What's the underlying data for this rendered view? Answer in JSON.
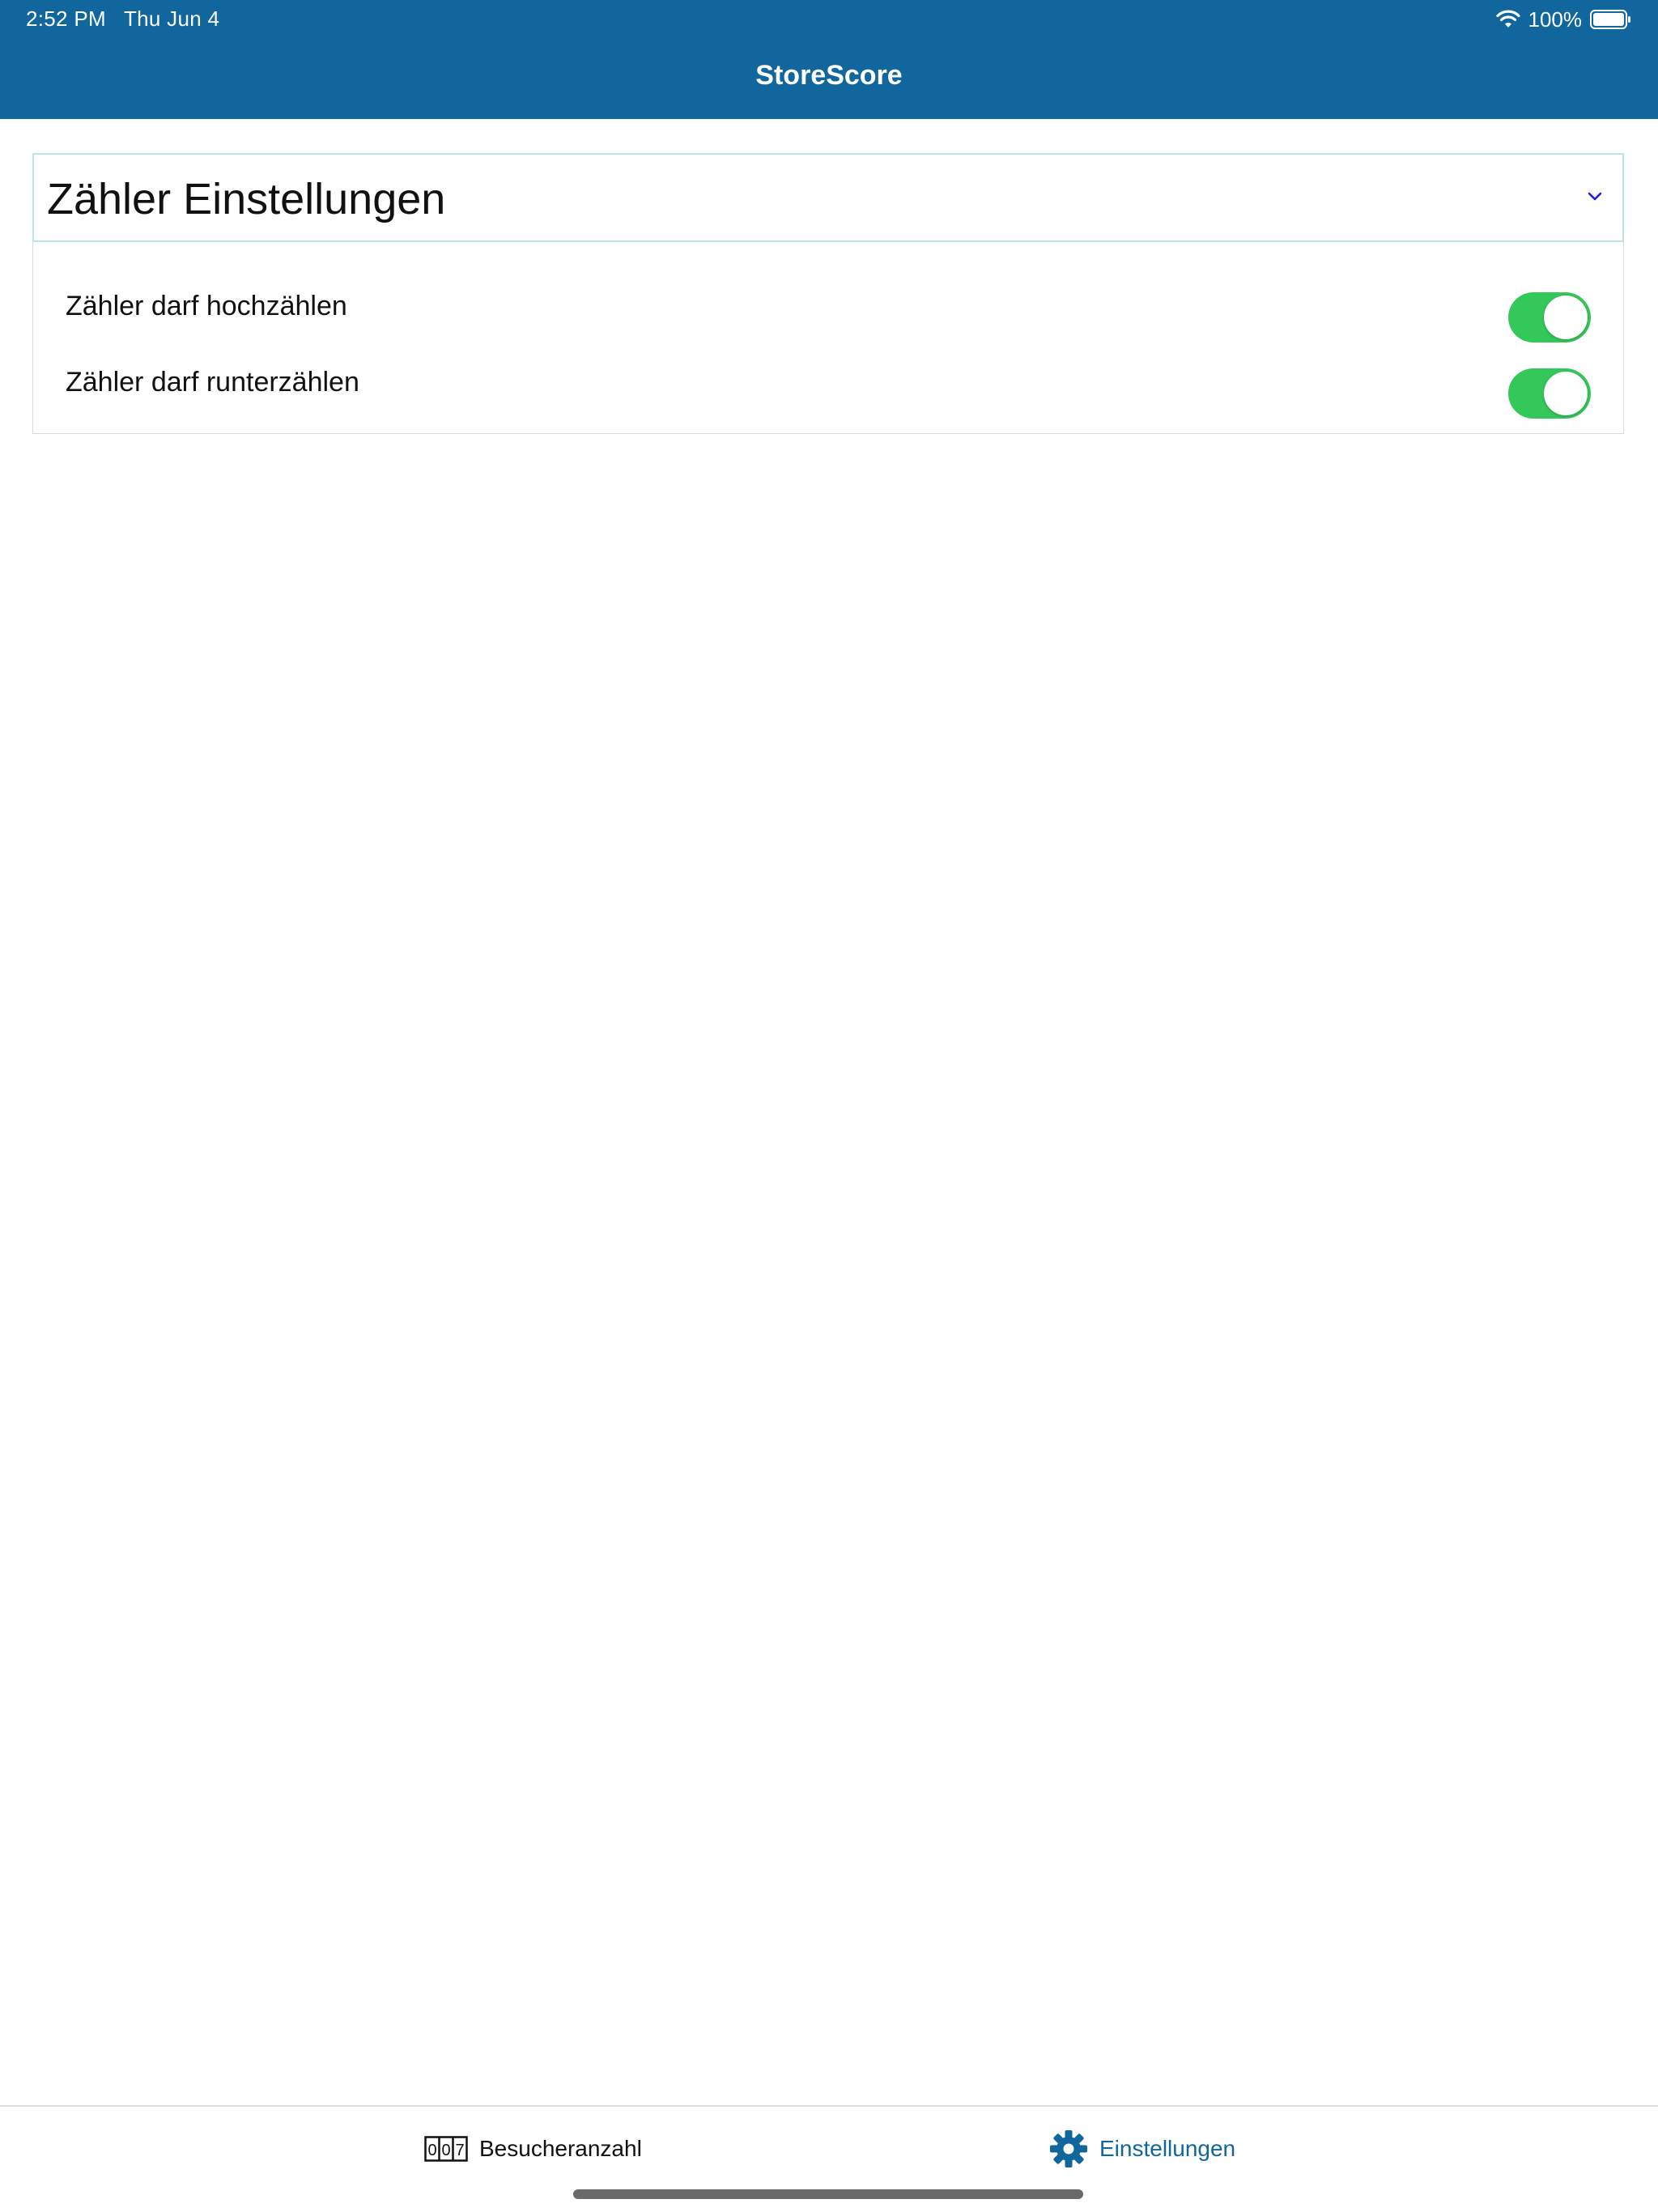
{
  "status_bar": {
    "time": "2:52 PM",
    "date": "Thu Jun 4",
    "battery": "100%",
    "icons": [
      "wifi-icon",
      "battery-icon"
    ]
  },
  "header": {
    "title": "StoreScore",
    "color": "#11669e"
  },
  "accordion": {
    "title": "Zähler Einstellungen",
    "icon": "chevron-down-icon",
    "expanded": true,
    "settings": [
      {
        "label": "Zähler darf hochzählen",
        "enabled": true
      },
      {
        "label": "Zähler darf runterzählen",
        "enabled": true
      }
    ]
  },
  "tabbar": {
    "tabs": [
      {
        "label": "Besucheranzahl",
        "icon": "counter-icon",
        "active": false
      },
      {
        "label": "Einstellungen",
        "icon": "gear-icon",
        "active": true
      }
    ]
  },
  "colors": {
    "accent": "#11669e",
    "toggle_on": "#34c759",
    "chevron": "#1a1aff"
  }
}
